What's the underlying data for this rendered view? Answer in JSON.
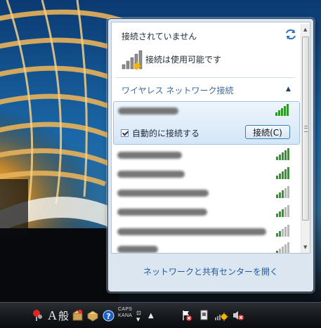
{
  "popup": {
    "status_title": "接続されていません",
    "status_text": "接続は使用可能です",
    "section_title": "ワイヤレス ネットワーク接続",
    "autoconnect_label": "自動的に接続する",
    "connect_button": "接続(C)",
    "footer_link": "ネットワークと共有センターを開く"
  },
  "networks": [
    {
      "signal": 5,
      "selected": true
    },
    {
      "signal": 5
    },
    {
      "signal": 5
    },
    {
      "signal": 4
    },
    {
      "signal": 4
    },
    {
      "signal": 3
    },
    {
      "signal": 2
    }
  ],
  "taskbar": {
    "ime_char": "A",
    "ime_mode": "般",
    "caps_label": "CAPS",
    "kana_label": "KANA"
  },
  "colors": {
    "link": "#1c5aa4",
    "signal_on": "#2f9a2a",
    "signal_off": "#b7b7b7"
  }
}
